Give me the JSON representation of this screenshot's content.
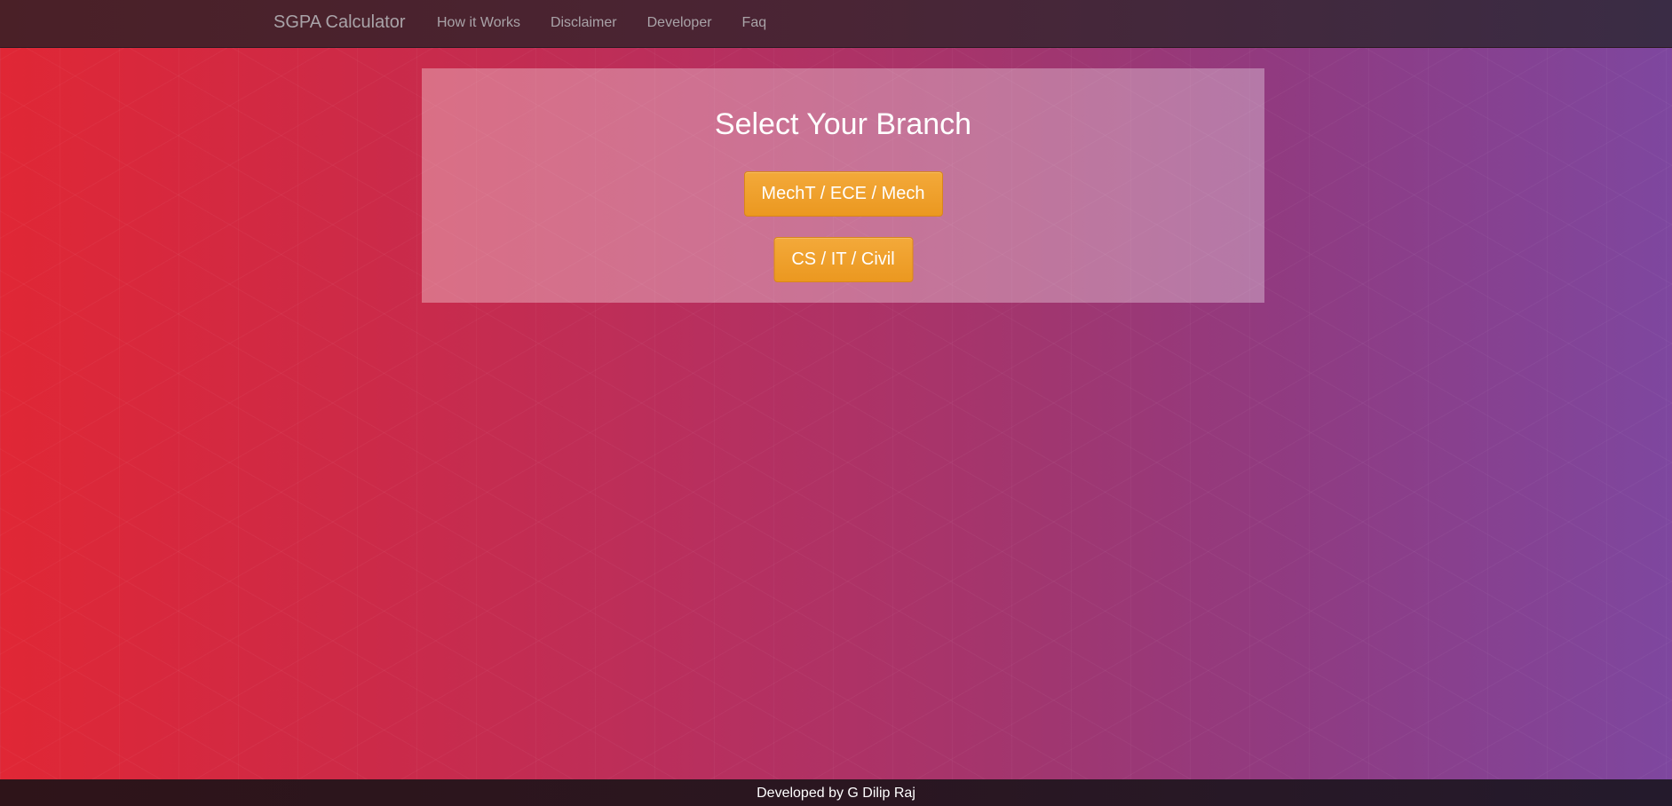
{
  "navbar": {
    "brand": "SGPA Calculator",
    "links": [
      {
        "label": "How it Works"
      },
      {
        "label": "Disclaimer"
      },
      {
        "label": "Developer"
      },
      {
        "label": "Faq"
      }
    ]
  },
  "main": {
    "title": "Select Your Branch",
    "buttons": [
      {
        "label": "MechT / ECE / Mech"
      },
      {
        "label": "CS / IT / Civil"
      }
    ]
  },
  "footer": {
    "text": "Developed by G Dilip Raj"
  },
  "colors": {
    "button": "#eb9820",
    "gradient_start": "#e02735",
    "gradient_end": "#7e479f"
  }
}
